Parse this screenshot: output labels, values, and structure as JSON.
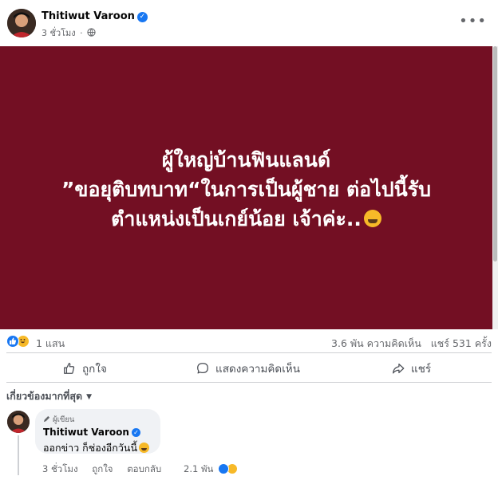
{
  "post": {
    "author": "Thitiwut Varoon",
    "time": "3 ชั่วโมง",
    "time_separator": "·",
    "banner_lines": [
      "ผู้ใหญ่บ้านฟินแลนด์",
      "”ขอยุติบทบาท“ในการเป็นผู้ชาย ต่อไปนี้รับ",
      "ตำแหน่งเป็นเกย์น้อย เจ้าค่ะ.."
    ],
    "banner_color": "#730f23"
  },
  "stats": {
    "reactions": "1 แสน",
    "comments_shares": "3.6 พัน ความคิดเห็น   แชร์ 531 ครั้ง"
  },
  "actions": {
    "like": "ถูกใจ",
    "comment": "แสดงความคิดเห็น",
    "share": "แชร์"
  },
  "sort_label": "เกี่ยวข้องมากที่สุด",
  "comment": {
    "badge": "ผู้เขียน",
    "author": "Thitiwut Varoon",
    "text": "ออกข่าว ก็ช่องอีกวันนี้",
    "time": "3 ชั่วโมง",
    "like": "ถูกใจ",
    "reply": "ตอบกลับ",
    "reactions": "2.1 พัน"
  },
  "colors": {
    "like_blue": "#1877f2",
    "haha_yellow": "#f7b928",
    "muted_text": "#65676b"
  },
  "icons": [
    "globe-icon",
    "more-icon",
    "like-icon",
    "comment-icon",
    "share-icon",
    "verified-icon",
    "pencil-icon",
    "haha-icon"
  ]
}
